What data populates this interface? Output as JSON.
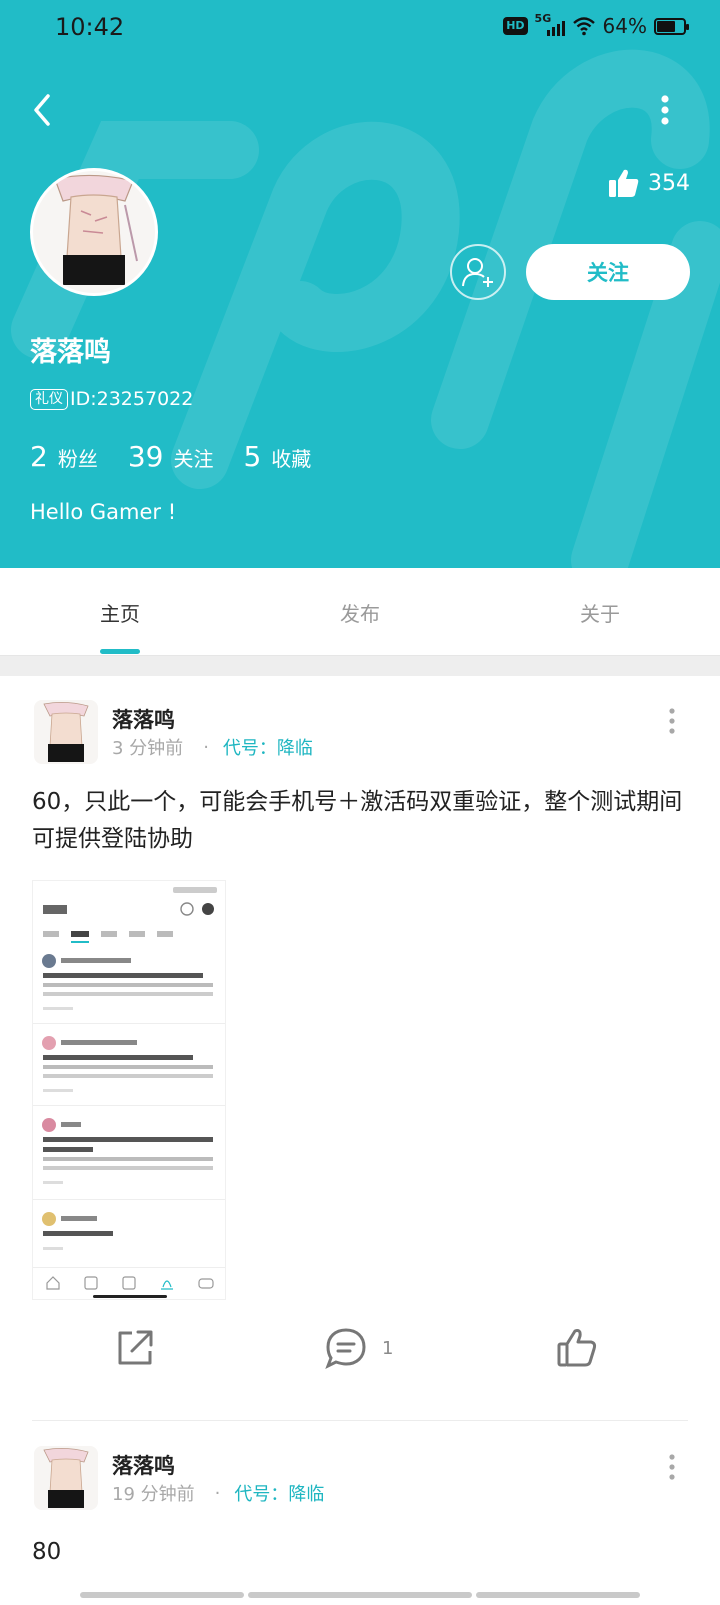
{
  "status_bar": {
    "time": "10:42",
    "hd": "HD",
    "network": "5G",
    "battery": "64%"
  },
  "profile": {
    "likes": "354",
    "follow_label": "关注",
    "name": "落落鸣",
    "id_tag": "礼仪",
    "id_text": "ID:23257022",
    "stats": [
      {
        "num": "2",
        "label": "粉丝"
      },
      {
        "num": "39",
        "label": "关注"
      },
      {
        "num": "5",
        "label": "收藏"
      }
    ],
    "bio": "Hello Gamer !"
  },
  "tabs": [
    {
      "label": "主页",
      "active": true
    },
    {
      "label": "发布",
      "active": false
    },
    {
      "label": "关于",
      "active": false
    }
  ],
  "posts": [
    {
      "author": "落落鸣",
      "time": "3 分钟前",
      "code": "代号：降临",
      "text": "60，只此一个，可能会手机号＋激活码双重验证，整个测试期间可提供登陆协助",
      "comments": "1"
    },
    {
      "author": "落落鸣",
      "time": "19 分钟前",
      "code": "代号：降临",
      "text": "80"
    }
  ],
  "colors": {
    "accent": "#21bcc7",
    "background": "#eeeeee"
  },
  "icons": [
    "back-icon",
    "more-icon",
    "thumbs-up-icon",
    "add-friend-icon",
    "share-icon",
    "comment-icon",
    "like-icon"
  ]
}
